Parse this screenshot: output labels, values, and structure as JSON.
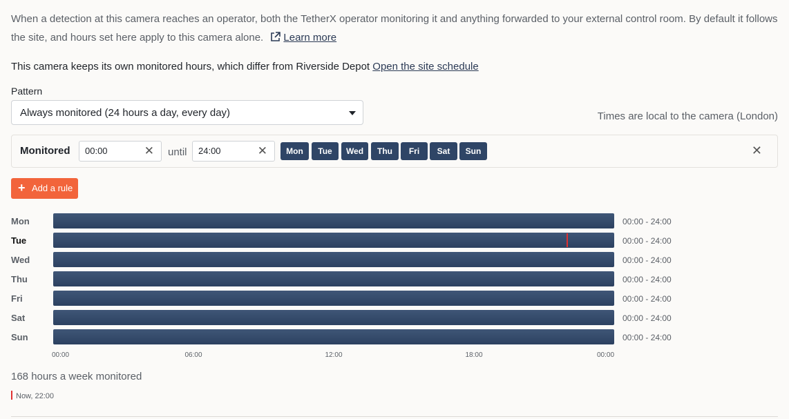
{
  "intro": {
    "text": "When a detection at this camera reaches an operator, both the TetherX operator monitoring it and anything forwarded to your external control room. By default it follows the site, and hours set here apply to this camera alone.",
    "learn_more": "Learn more",
    "learn_more_icon": "external-link-icon"
  },
  "notice": {
    "text": "This camera keeps its own monitored hours, which differ from Riverside Depot",
    "link": "Open the site schedule"
  },
  "pattern": {
    "label": "Pattern",
    "selected": "Always monitored (24 hours a day, every day)"
  },
  "timezone_note": "Times are local to the camera (London)",
  "rule": {
    "label": "Monitored",
    "from": "00:00",
    "until_label": "until",
    "to": "24:00",
    "days": [
      "Mon",
      "Tue",
      "Wed",
      "Thu",
      "Fri",
      "Sat",
      "Sun"
    ]
  },
  "add_rule": {
    "label": "Add a rule",
    "icon": "plus-icon"
  },
  "chart_data": {
    "type": "timeline",
    "days": [
      "Mon",
      "Tue",
      "Wed",
      "Thu",
      "Fri",
      "Sat",
      "Sun"
    ],
    "today": "Tue",
    "hour_range": [
      0,
      24
    ],
    "bars": [
      {
        "day": "Mon",
        "start": 0,
        "end": 24,
        "label": "00:00 - 24:00"
      },
      {
        "day": "Tue",
        "start": 0,
        "end": 24,
        "label": "00:00 - 24:00"
      },
      {
        "day": "Wed",
        "start": 0,
        "end": 24,
        "label": "00:00 - 24:00"
      },
      {
        "day": "Thu",
        "start": 0,
        "end": 24,
        "label": "00:00 - 24:00"
      },
      {
        "day": "Fri",
        "start": 0,
        "end": 24,
        "label": "00:00 - 24:00"
      },
      {
        "day": "Sat",
        "start": 0,
        "end": 24,
        "label": "00:00 - 24:00"
      },
      {
        "day": "Sun",
        "start": 0,
        "end": 24,
        "label": "00:00 - 24:00"
      }
    ],
    "x_ticks": [
      {
        "hour": 0,
        "label": "00:00"
      },
      {
        "hour": 6,
        "label": "06:00"
      },
      {
        "hour": 12,
        "label": "12:00"
      },
      {
        "hour": 18,
        "label": "18:00"
      },
      {
        "hour": 24,
        "label": "00:00"
      }
    ],
    "now_hour": 22,
    "now_color": "#e03030",
    "bar_color": "#2f4566"
  },
  "summary": "168 hours a week monitored",
  "legend": {
    "now_label": "Now, 22:00"
  },
  "colors": {
    "accent": "#f2643b",
    "day_button": "#2f4566"
  }
}
